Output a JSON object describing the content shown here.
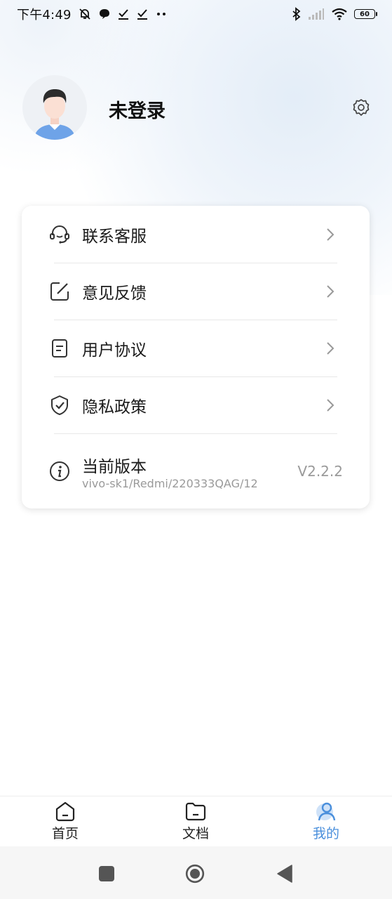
{
  "status_bar": {
    "time": "下午4:49",
    "left_icons": [
      "mute-icon",
      "chat-bubble-icon",
      "check-icon",
      "check-icon",
      "more-dots-icon"
    ],
    "right_icons": [
      "bluetooth-icon",
      "signal-icon",
      "wifi-icon"
    ],
    "battery": "60"
  },
  "profile": {
    "name": "未登录"
  },
  "menu": {
    "items": [
      {
        "label": "联系客服",
        "icon": "headset-icon"
      },
      {
        "label": "意见反馈",
        "icon": "edit-icon"
      },
      {
        "label": "用户协议",
        "icon": "document-icon"
      },
      {
        "label": "隐私政策",
        "icon": "shield-check-icon"
      }
    ],
    "version": {
      "label": "当前版本",
      "detail": "vivo-sk1/Redmi/220333QAG/12",
      "value": "V2.2.2",
      "icon": "info-icon"
    }
  },
  "bottom_nav": {
    "tabs": [
      {
        "label": "首页",
        "icon": "home-icon",
        "active": false
      },
      {
        "label": "文档",
        "icon": "folder-icon",
        "active": false
      },
      {
        "label": "我的",
        "icon": "user-icon",
        "active": true
      }
    ]
  },
  "system_nav": [
    "recents-square-icon",
    "home-circle-icon",
    "back-triangle-icon"
  ],
  "colors": {
    "accent": "#4a8fdc",
    "text_primary": "#1a1a1a",
    "text_secondary": "#9a9a9a"
  }
}
